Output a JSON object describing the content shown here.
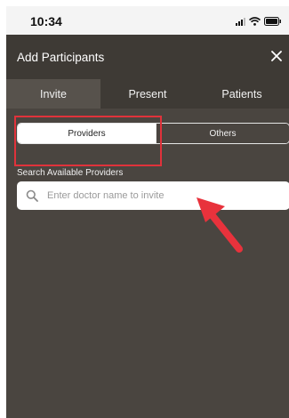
{
  "status_bar": {
    "time": "10:34"
  },
  "header": {
    "title": "Add Participants"
  },
  "tabs": [
    {
      "label": "Invite"
    },
    {
      "label": "Present"
    },
    {
      "label": "Patients"
    }
  ],
  "segmented": {
    "providers_label": "Providers",
    "others_label": "Others"
  },
  "search": {
    "label": "Search Available Providers",
    "placeholder": "Enter doctor name to invite",
    "value": ""
  },
  "colors": {
    "highlight": "#e0323b",
    "header_bg": "#3e3a35",
    "content_bg": "#4a4540",
    "active_tab_bg": "#57524c"
  },
  "icons": [
    "signal-icon",
    "wifi-icon",
    "battery-icon",
    "close-icon",
    "search-icon",
    "arrow-pointer-icon"
  ]
}
